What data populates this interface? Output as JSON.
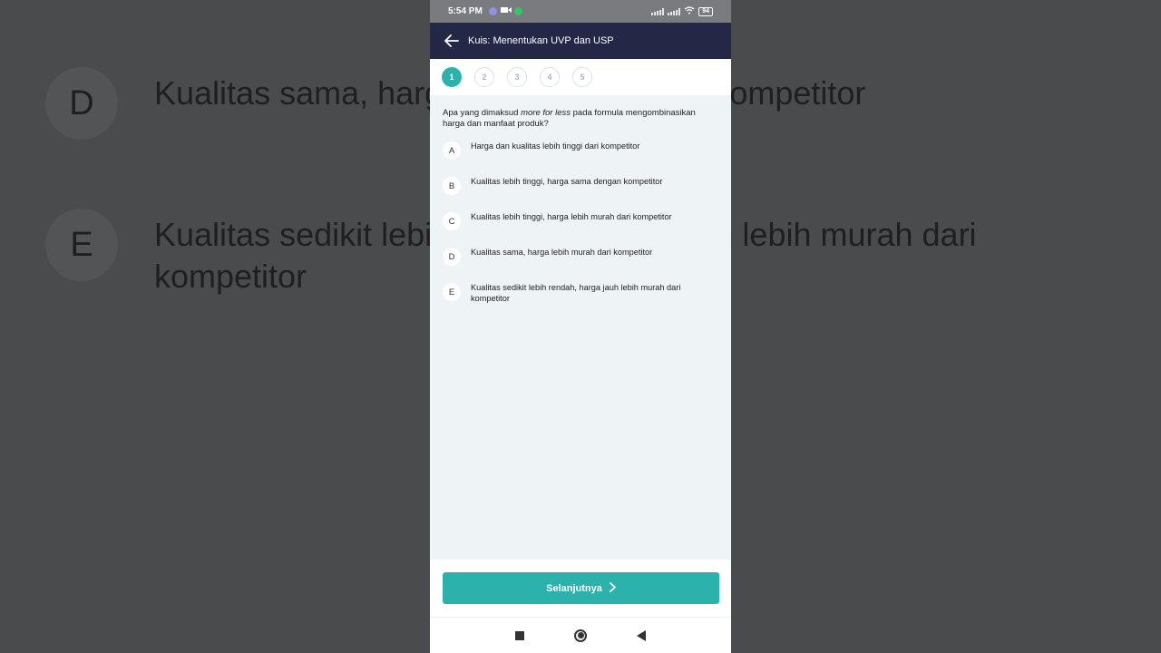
{
  "background": {
    "options": [
      {
        "letter": "D",
        "text": "Kualitas sama, harga lebih murah dari kompetitor"
      },
      {
        "letter": "E",
        "text": "Kualitas sedikit lebih rendah, harga jauh lebih murah dari kompetitor"
      }
    ]
  },
  "status_bar": {
    "time": "5:54 PM",
    "battery": "94"
  },
  "header": {
    "title": "Kuis: Menentukan UVP dan USP"
  },
  "steps": [
    "1",
    "2",
    "3",
    "4",
    "5"
  ],
  "active_step": "1",
  "question": {
    "prefix": "Apa yang dimaksud ",
    "emphasis": "more for less",
    "suffix": " pada formula mengombinasikan harga dan manfaat produk?"
  },
  "options": [
    {
      "letter": "A",
      "text": "Harga dan kualitas lebih tinggi dari kompetitor"
    },
    {
      "letter": "B",
      "text": "Kualitas lebih tinggi, harga sama dengan kompetitor"
    },
    {
      "letter": "C",
      "text": "Kualitas lebih tinggi, harga lebih murah dari kompetitor"
    },
    {
      "letter": "D",
      "text": "Kualitas sama, harga lebih murah dari kompetitor"
    },
    {
      "letter": "E",
      "text": "Kualitas sedikit lebih rendah, harga jauh lebih murah dari kompetitor"
    }
  ],
  "footer": {
    "next_label": "Selanjutnya"
  },
  "colors": {
    "accent": "#2cb2ac",
    "header_bg": "#232846"
  }
}
